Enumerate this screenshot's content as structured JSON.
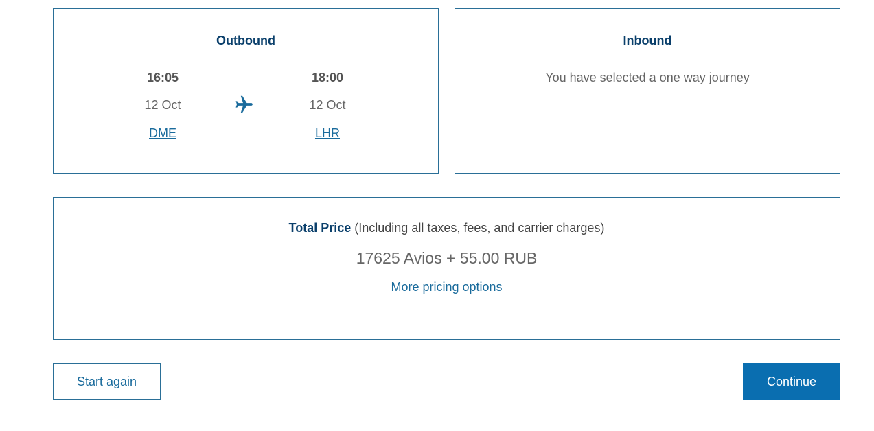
{
  "outbound": {
    "title": "Outbound",
    "departure": {
      "time": "16:05",
      "date": "12 Oct",
      "airport": "DME"
    },
    "arrival": {
      "time": "18:00",
      "date": "12 Oct",
      "airport": "LHR"
    },
    "icon": "plane-icon"
  },
  "inbound": {
    "title": "Inbound",
    "message": "You have selected a one way journey"
  },
  "price": {
    "heading_bold": "Total Price",
    "heading_note": "(Including all taxes, fees, and carrier charges)",
    "value": "17625 Avios + 55.00 RUB",
    "more_link": "More pricing options"
  },
  "actions": {
    "start_again": "Start again",
    "continue": "Continue"
  },
  "colors": {
    "border": "#2a6f97",
    "heading": "#0a3f6b",
    "link": "#1a6b9c",
    "primary_button": "#0a6eb0"
  }
}
